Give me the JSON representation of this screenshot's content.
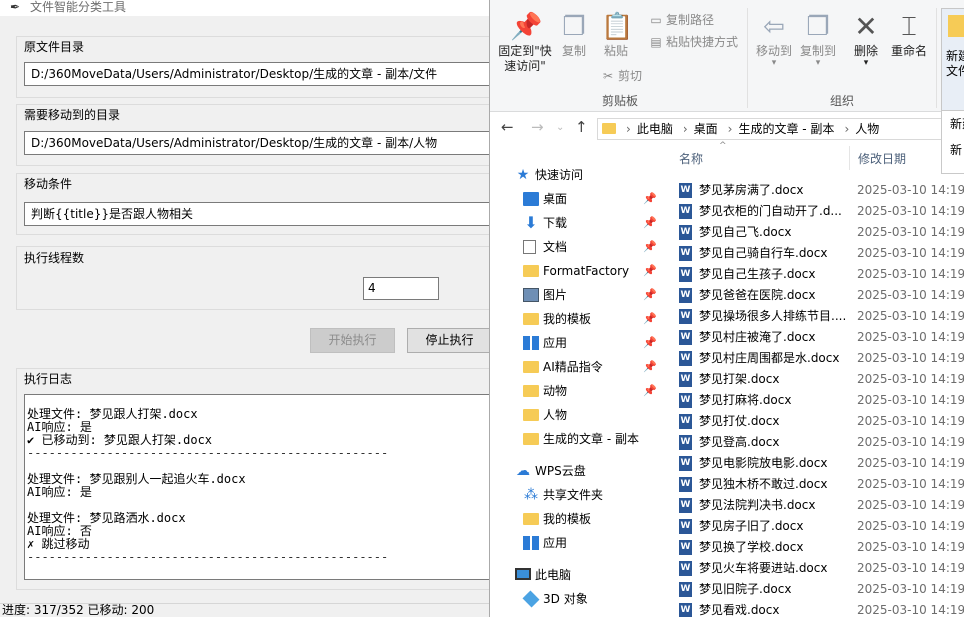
{
  "app": {
    "title": "文件智能分类工具",
    "source_label": "原文件目录",
    "source_value": "D:/360MoveData/Users/Administrator/Desktop/生成的文章 - 副本/文件",
    "target_label": "需要移动到的目录",
    "target_value": "D:/360MoveData/Users/Administrator/Desktop/生成的文章 - 副本/人物",
    "condition_label": "移动条件",
    "condition_value": "判断{{title}}是否跟人物相关",
    "threads_label": "执行线程数",
    "threads_value": "4",
    "start_button": "开始执行",
    "stop_button": "停止执行",
    "log_label": "执行日志",
    "log_lines": [
      "处理文件: 梦见跟人打架.docx",
      "AI响应: 是",
      "✔ 已移动到: 梦见跟人打架.docx",
      "--------------------------------------------------",
      "",
      "处理文件: 梦见跟别人一起追火车.docx",
      "AI响应: 是",
      "",
      "处理文件: 梦见路洒水.docx",
      "AI响应: 否",
      "✗ 跳过移动",
      "--------------------------------------------------"
    ],
    "status": "进度: 317/352 已移动: 200"
  },
  "explorer": {
    "ribbon": {
      "pin_label": "固定到\"快速访问\"",
      "copy_label": "复制",
      "paste_label": "粘贴",
      "copy_path_label": "复制路径",
      "paste_shortcut_label": "粘贴快捷方式",
      "cut_label": "剪切",
      "clipboard_group": "剪贴板",
      "move_to_label": "移动到",
      "copy_to_label": "复制到",
      "delete_label": "删除",
      "rename_label": "重命名",
      "organize_group": "组织",
      "new_label": "新建文件"
    },
    "address": [
      "此电脑",
      "桌面",
      "生成的文章 - 副本",
      "人物"
    ],
    "popup_items": [
      "新建",
      "新"
    ],
    "columns": {
      "name": "名称",
      "modified": "修改日期"
    },
    "nav_items": [
      {
        "label": "快速访问",
        "icon": "star-icon",
        "pinned": false
      },
      {
        "label": "桌面",
        "icon": "desktop-icon",
        "pinned": true
      },
      {
        "label": "下载",
        "icon": "download-icon",
        "pinned": true
      },
      {
        "label": "文档",
        "icon": "document-icon",
        "pinned": true
      },
      {
        "label": "FormatFactory",
        "icon": "folder-icon",
        "pinned": true
      },
      {
        "label": "图片",
        "icon": "picture-icon",
        "pinned": true
      },
      {
        "label": "我的模板",
        "icon": "folder-icon",
        "pinned": true
      },
      {
        "label": "应用",
        "icon": "apps-icon",
        "pinned": true
      },
      {
        "label": "AI精品指令",
        "icon": "folder-icon",
        "pinned": true
      },
      {
        "label": "动物",
        "icon": "folder-icon",
        "pinned": true
      },
      {
        "label": "人物",
        "icon": "folder-icon",
        "pinned": false
      },
      {
        "label": "生成的文章 - 副本",
        "icon": "folder-icon",
        "pinned": false
      },
      {
        "label": "WPS云盘",
        "icon": "cloud-icon",
        "pinned": false
      },
      {
        "label": "共享文件夹",
        "icon": "share-icon",
        "pinned": false
      },
      {
        "label": "我的模板",
        "icon": "folder-icon",
        "pinned": false
      },
      {
        "label": "应用",
        "icon": "apps-icon",
        "pinned": false
      },
      {
        "label": "此电脑",
        "icon": "computer-icon",
        "pinned": false
      },
      {
        "label": "3D 对象",
        "icon": "cube-icon",
        "pinned": false
      }
    ],
    "files": [
      {
        "name": "梦见茅房满了.docx",
        "date": "2025-03-10 14:19"
      },
      {
        "name": "梦见衣柜的门自动开了.d...",
        "date": "2025-03-10 14:19"
      },
      {
        "name": "梦见自己飞.docx",
        "date": "2025-03-10 14:19"
      },
      {
        "name": "梦见自己骑自行车.docx",
        "date": "2025-03-10 14:19"
      },
      {
        "name": "梦见自己生孩子.docx",
        "date": "2025-03-10 14:19"
      },
      {
        "name": "梦见爸爸在医院.docx",
        "date": "2025-03-10 14:19"
      },
      {
        "name": "梦见操场很多人排练节目....",
        "date": "2025-03-10 14:19"
      },
      {
        "name": "梦见村庄被淹了.docx",
        "date": "2025-03-10 14:19"
      },
      {
        "name": "梦见村庄周围都是水.docx",
        "date": "2025-03-10 14:19"
      },
      {
        "name": "梦见打架.docx",
        "date": "2025-03-10 14:19"
      },
      {
        "name": "梦见打麻将.docx",
        "date": "2025-03-10 14:19"
      },
      {
        "name": "梦见打仗.docx",
        "date": "2025-03-10 14:19"
      },
      {
        "name": "梦见登高.docx",
        "date": "2025-03-10 14:19"
      },
      {
        "name": "梦见电影院放电影.docx",
        "date": "2025-03-10 14:19"
      },
      {
        "name": "梦见独木桥不敢过.docx",
        "date": "2025-03-10 14:19"
      },
      {
        "name": "梦见法院判决书.docx",
        "date": "2025-03-10 14:19"
      },
      {
        "name": "梦见房子旧了.docx",
        "date": "2025-03-10 14:19"
      },
      {
        "name": "梦见换了学校.docx",
        "date": "2025-03-10 14:19"
      },
      {
        "name": "梦见火车将要进站.docx",
        "date": "2025-03-10 14:19"
      },
      {
        "name": "梦见旧院子.docx",
        "date": "2025-03-10 14:19"
      },
      {
        "name": "梦见看戏.docx",
        "date": "2025-03-10 14:19"
      }
    ]
  }
}
